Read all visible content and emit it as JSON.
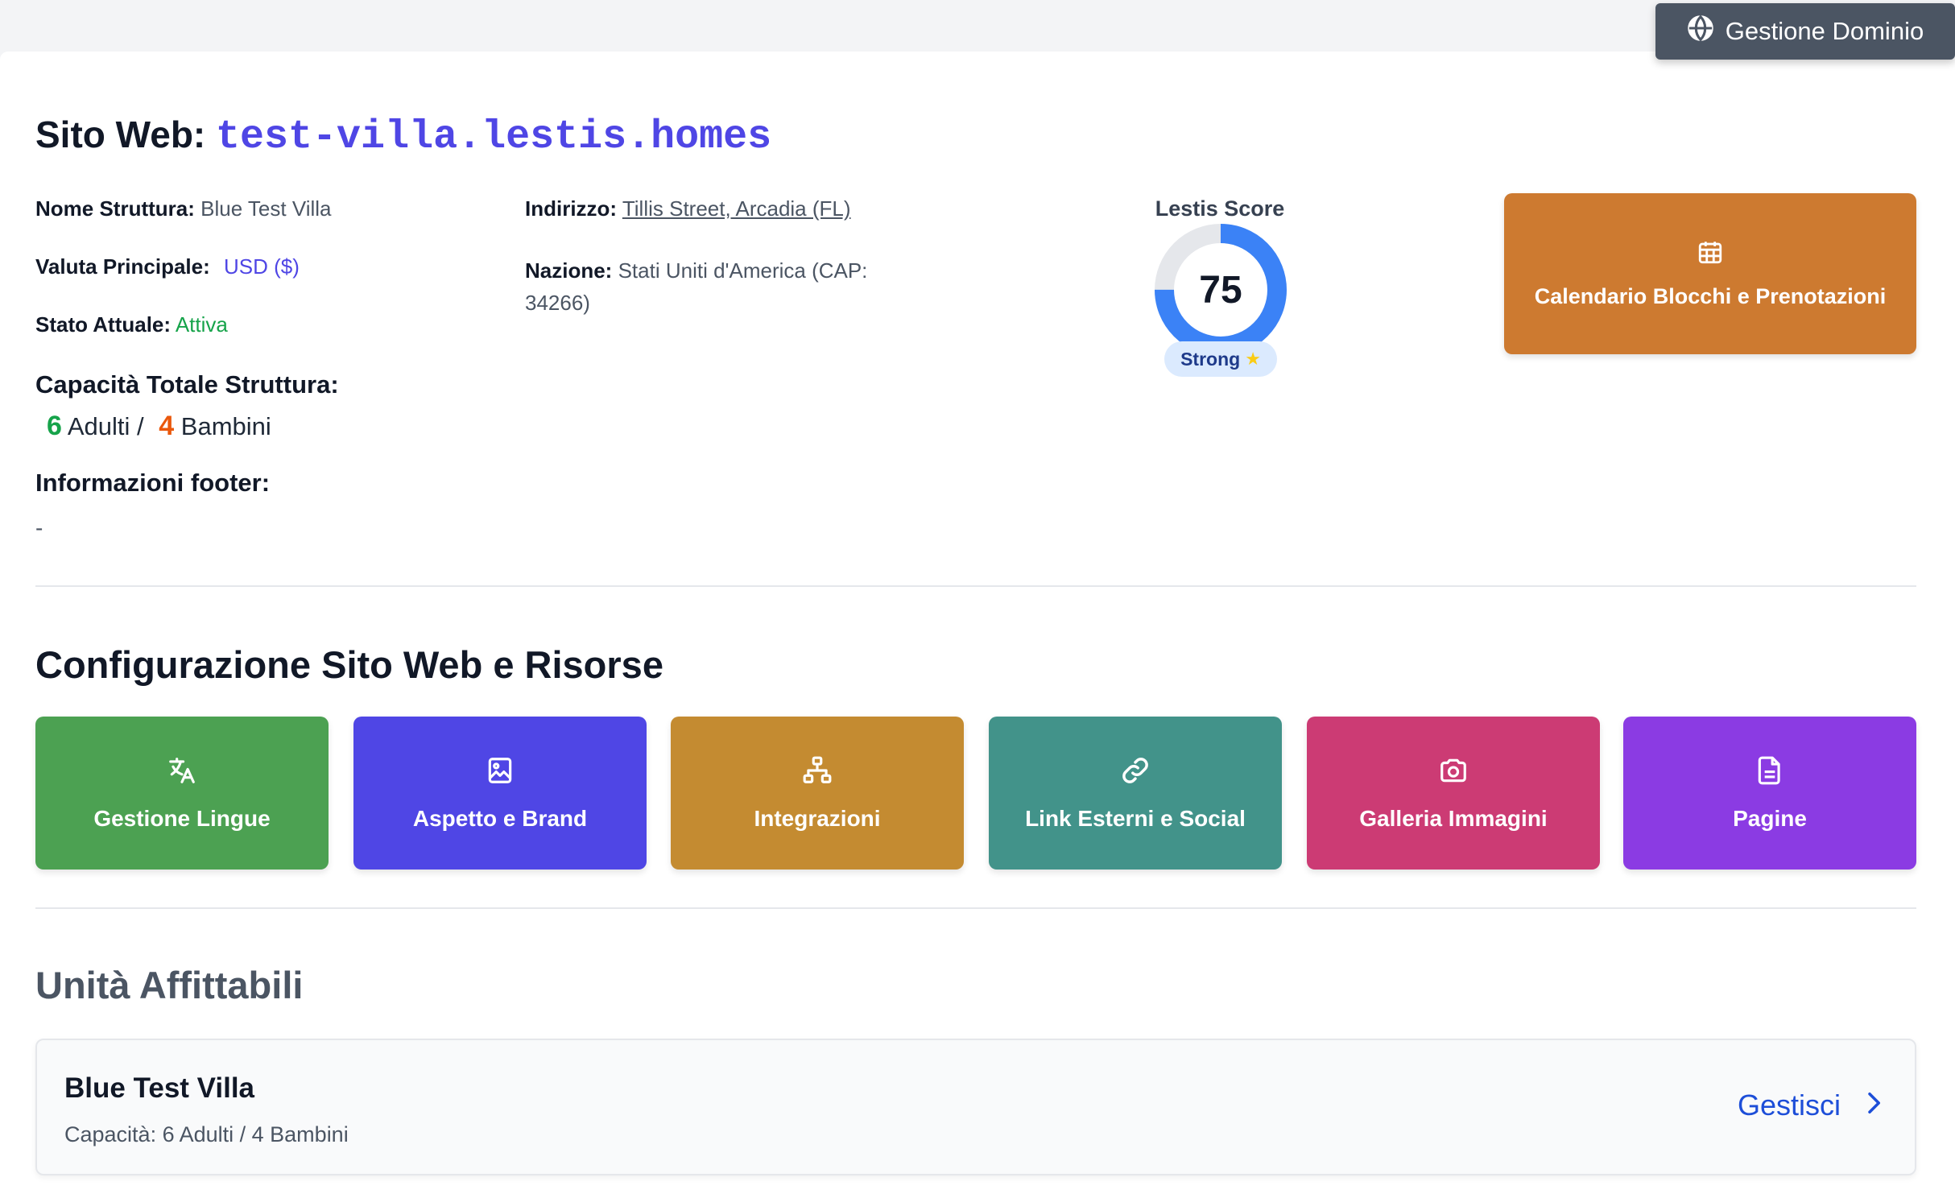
{
  "header": {
    "domain_button_label": "Gestione Dominio"
  },
  "site": {
    "title_prefix": "Sito Web:",
    "domain": "test-villa.lestis.homes"
  },
  "details": {
    "nome_label": "Nome Struttura:",
    "nome_value": "Blue Test Villa",
    "valuta_label": "Valuta Principale:",
    "valuta_value": "USD ($)",
    "stato_label": "Stato Attuale:",
    "stato_value": "Attiva",
    "indirizzo_label": "Indirizzo:",
    "indirizzo_value": "Tillis Street, Arcadia (FL)",
    "nazione_label": "Nazione:",
    "nazione_value_line1": "Stati Uniti d'America (CAP:",
    "nazione_value_line2": "34266)",
    "capacity_label": "Capacità Totale Struttura:",
    "adults_count": "6",
    "adults_label": "Adulti /",
    "children_count": "4",
    "children_label": "Bambini",
    "footer_label": "Informazioni footer:",
    "footer_value": "-"
  },
  "score": {
    "title": "Lestis Score",
    "value": 75,
    "value_text": "75",
    "badge": "Strong",
    "badge_icon": "star-icon",
    "ring_color": "#3b82f6",
    "track_color": "#e5e7eb"
  },
  "calendar_button": {
    "label": "Calendario Blocchi e Prenotazioni",
    "icon": "calendar-icon",
    "color": "#cd7a30"
  },
  "config": {
    "title": "Configurazione Sito Web e Risorse",
    "tiles": [
      {
        "label": "Gestione Lingue",
        "icon": "translate-icon",
        "color": "#4ca152"
      },
      {
        "label": "Aspetto e Brand",
        "icon": "image-icon",
        "color": "#4f46e5"
      },
      {
        "label": "Integrazioni",
        "icon": "network-icon",
        "color": "#c48b31"
      },
      {
        "label": "Link Esterni e Social",
        "icon": "link-icon",
        "color": "#42938a"
      },
      {
        "label": "Galleria Immagini",
        "icon": "camera-icon",
        "color": "#cc3b74"
      },
      {
        "label": "Pagine",
        "icon": "document-icon",
        "color": "#8b3be3"
      }
    ]
  },
  "units": {
    "title": "Unità Affittabili",
    "items": [
      {
        "name": "Blue Test Villa",
        "capacity": "Capacità: 6 Adulti / 4 Bambini",
        "action": "Gestisci"
      }
    ]
  }
}
